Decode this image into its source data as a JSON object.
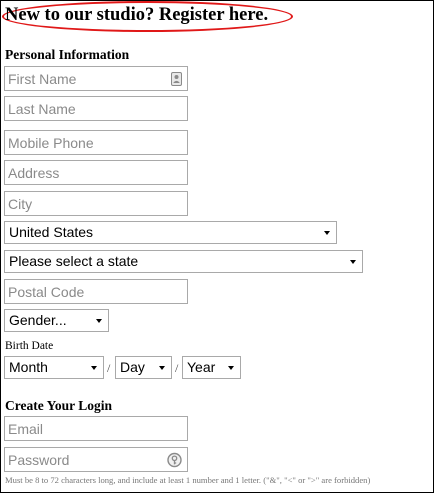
{
  "header": {
    "title": "New to our studio? Register here."
  },
  "personal": {
    "section_title": "Personal Information",
    "first_name_placeholder": "First Name",
    "last_name_placeholder": "Last Name",
    "mobile_phone_placeholder": "Mobile Phone",
    "address_placeholder": "Address",
    "city_placeholder": "City",
    "country_selected": "United States",
    "state_selected": "Please select a state",
    "postal_code_placeholder": "Postal Code",
    "gender_selected": "Gender...",
    "birth_date_label": "Birth Date",
    "month_selected": "Month",
    "day_selected": "Day",
    "year_selected": "Year",
    "date_separator": "/"
  },
  "login": {
    "section_title": "Create Your Login",
    "email_placeholder": "Email",
    "password_placeholder": "Password",
    "password_hint": "Must be 8 to 72 characters long, and include at least 1 number and 1 letter. (\"&\", \"<\" or \">\" are forbidden)"
  },
  "icons": {
    "first_name_field_icon": "contact-card-icon",
    "password_field_icon": "password-manager-key-icon"
  },
  "colors": {
    "heading_outline": "#e01818",
    "placeholder": "#8a8a8a",
    "field_border": "#a9a9a9"
  }
}
